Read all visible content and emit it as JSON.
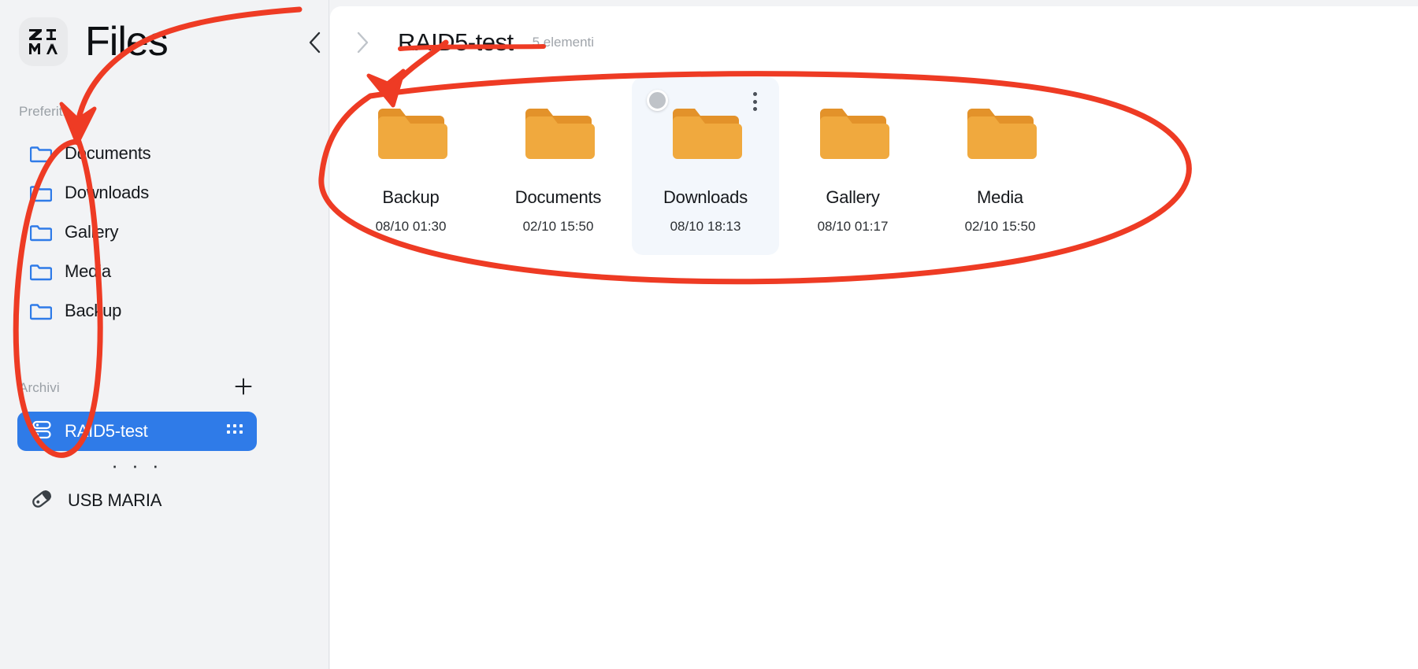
{
  "app": {
    "title": "Files",
    "logo_text_top": "ZI",
    "logo_text_bottom": "MA"
  },
  "colors": {
    "accent": "#2F7BE8",
    "folder_icon_blue": "#2F7BE8",
    "folder_body": "#F0A93E",
    "folder_tab": "#E3922A",
    "sidebar_bg": "#F2F3F5",
    "main_bg": "#FFFFFF",
    "hover_card_bg": "#F3F7FC",
    "annotation_red": "#EE3B24",
    "muted_text": "#9AA0A6"
  },
  "sidebar": {
    "sections": {
      "favorites_label": "Preferiti",
      "archives_label": "Archivi"
    },
    "add_button_name": "add-archive-button",
    "favorites": [
      {
        "label": "Documents",
        "icon": "folder-icon"
      },
      {
        "label": "Downloads",
        "icon": "folder-icon"
      },
      {
        "label": "Gallery",
        "icon": "folder-icon"
      },
      {
        "label": "Media",
        "icon": "folder-icon"
      },
      {
        "label": "Backup",
        "icon": "folder-icon"
      }
    ],
    "archives": [
      {
        "label": "RAID5-test",
        "icon": "storage-stack-icon",
        "trailing_icon": "grid-apps-icon",
        "selected": true
      }
    ],
    "more_indicator": "· · ·",
    "devices": [
      {
        "label": "USB MARIA",
        "icon": "usb-drive-icon"
      }
    ]
  },
  "main": {
    "nav": {
      "back_icon": "chevron-left-icon",
      "forward_icon": "chevron-right-icon"
    },
    "breadcrumb_title": "RAID5-test",
    "item_count": "5 elementi",
    "items": [
      {
        "name": "Backup",
        "date": "08/10 01:30",
        "icon": "folder-icon",
        "hovered": false
      },
      {
        "name": "Documents",
        "date": "02/10 15:50",
        "icon": "folder-icon",
        "hovered": false
      },
      {
        "name": "Downloads",
        "date": "08/10 18:13",
        "icon": "folder-icon",
        "hovered": true
      },
      {
        "name": "Gallery",
        "date": "08/10 01:17",
        "icon": "folder-icon",
        "hovered": false
      },
      {
        "name": "Media",
        "date": "02/10 15:50",
        "icon": "folder-icon",
        "hovered": false
      }
    ],
    "hovered_card": {
      "select_circle": "selection-circle",
      "menu_icon": "more-vertical-icon"
    }
  },
  "annotations": {
    "ellipse_sidebar": "hand-drawn-ellipse-around-favorites",
    "ellipse_main": "hand-drawn-ellipse-around-folder-grid",
    "arrow_to_sidebar": "hand-drawn-arrow-pointing-to-favorites",
    "arrow_to_grid": "hand-drawn-arrow-pointing-to-backup-folder",
    "underline_title": "hand-drawn-underline-under-breadcrumb-title"
  }
}
